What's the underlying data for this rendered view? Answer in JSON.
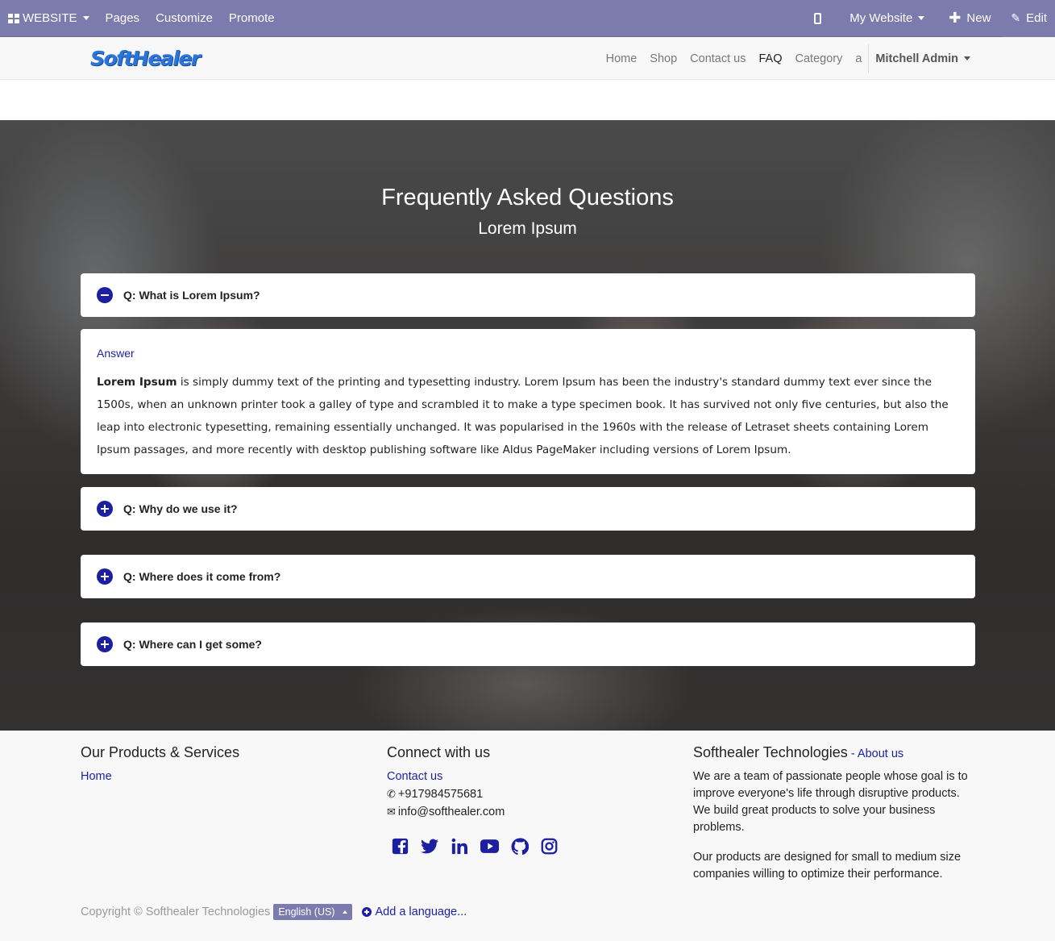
{
  "admin_bar": {
    "website_label": "WEBSITE",
    "pages_label": "Pages",
    "customize_label": "Customize",
    "promote_label": "Promote",
    "my_website_label": "My Website",
    "new_label": "New",
    "edit_label": "Edit",
    "background_color": "#7c7bad"
  },
  "navbar": {
    "logo_text": "SoftHealer",
    "menu": [
      "Home",
      "Shop",
      "Contact us",
      "FAQ",
      "Category",
      "a"
    ],
    "active_item": "FAQ",
    "user_name": "Mitchell Admin"
  },
  "hero": {
    "title": "Frequently Asked Questions",
    "subtitle": "Lorem Ipsum"
  },
  "faq": {
    "items": [
      {
        "question": "Q: What is Lorem Ipsum?",
        "expanded": true
      },
      {
        "question": "Q: Why do we use it?",
        "expanded": false
      },
      {
        "question": "Q: Where does it come from?",
        "expanded": false
      },
      {
        "question": "Q: Where can I get some?",
        "expanded": false
      }
    ],
    "answer_label": "Answer",
    "answer_bold": "Lorem Ipsum",
    "answer_text": " is simply dummy text of the printing and typesetting industry. Lorem Ipsum has been the industry's standard dummy text ever since the 1500s, when an unknown printer took a galley of type and scrambled it to make a type specimen book. It has survived not only five centuries, but also the leap into electronic typesetting, remaining essentially unchanged. It was popularised in the 1960s with the release of Letraset sheets containing Lorem Ipsum passages, and more recently with desktop publishing software like Aldus PageMaker including versions of Lorem Ipsum."
  },
  "footer": {
    "products": {
      "heading": "Our Products & Services",
      "links": [
        "Home"
      ]
    },
    "connect": {
      "heading": "Connect with us",
      "contact_link": "Contact us",
      "phone": "+917984575681",
      "email": "info@softhealer.com",
      "social_icons": [
        "facebook-icon",
        "twitter-icon",
        "linkedin-icon",
        "youtube-icon",
        "github-icon",
        "instagram-icon"
      ]
    },
    "about": {
      "heading": "Softhealer Technologies",
      "separator": " - ",
      "about_link": "About us",
      "para1": "We are a team of passionate people whose goal is to improve everyone's life through disruptive products. We build great products to solve your business problems.",
      "para2": "Our products are designed for small to medium size companies willing to optimize their performance."
    },
    "copyright": "Copyright © Softhealer Technologies",
    "language": "English (US)",
    "add_language": "Add a language..."
  },
  "colors": {
    "accent": "#1c1fa0",
    "admin_bar": "#7c7bad"
  }
}
